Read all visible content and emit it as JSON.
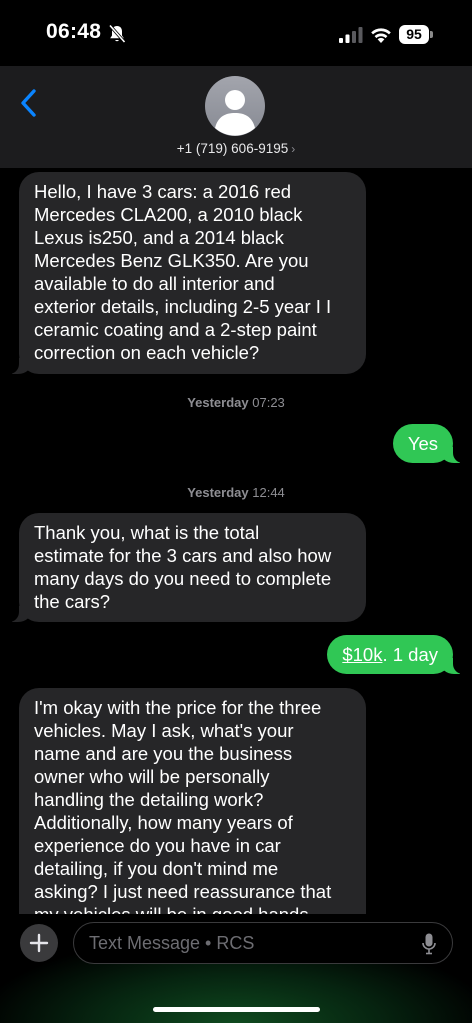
{
  "status_bar": {
    "time": "06:48",
    "battery": "95",
    "icons": [
      "bell-slash-icon",
      "cellular-signal-icon",
      "wifi-icon",
      "battery-icon"
    ]
  },
  "header": {
    "back_icon": "chevron-left-icon",
    "avatar_icon": "person-avatar-icon",
    "contact": "+1 (719) 606-9195",
    "chevron": "›"
  },
  "messages": [
    {
      "direction": "incoming",
      "lines": [
        "Hello, I have 3 cars: a 2016 red",
        "Mercedes CLA200, a 2010 black",
        "Lexus is250, and a 2014 black",
        "Mercedes Benz GLK350. Are you",
        "available to do all interior and",
        "exterior details, including 2-5 year I I",
        "ceramic coating and a 2-step paint",
        "correction on each vehicle?"
      ]
    },
    {
      "direction": "timestamp",
      "day": "Yesterday",
      "time": "07:23"
    },
    {
      "direction": "outgoing",
      "text": "Yes"
    },
    {
      "direction": "timestamp",
      "day": "Yesterday",
      "time": "12:44"
    },
    {
      "direction": "incoming",
      "lines": [
        "Thank you, what is the total",
        "estimate for the 3 cars and also how",
        "many days do you need to complete",
        "the cars?"
      ]
    },
    {
      "direction": "outgoing",
      "link_text": "$10k",
      "rest_text": ". 1 day"
    },
    {
      "direction": "incoming",
      "lines": [
        "I'm okay with the price for the three",
        "vehicles. May I ask, what's your",
        "name and are you the business",
        "owner who will be personally",
        "handling the detailing work?",
        "Additionally, how many years of",
        "experience do you have in car",
        "detailing, if you don't mind me",
        "asking? I just need reassurance that",
        "my vehicles will be in good hands."
      ]
    }
  ],
  "compose": {
    "plus_icon": "plus-icon",
    "placeholder": "Text Message • RCS",
    "mic_icon": "microphone-icon"
  },
  "colors": {
    "incoming_bubble": "#262628",
    "outgoing_bubble": "#30c755",
    "accent_blue": "#0a84ff",
    "timestamp": "#8e8e93"
  }
}
